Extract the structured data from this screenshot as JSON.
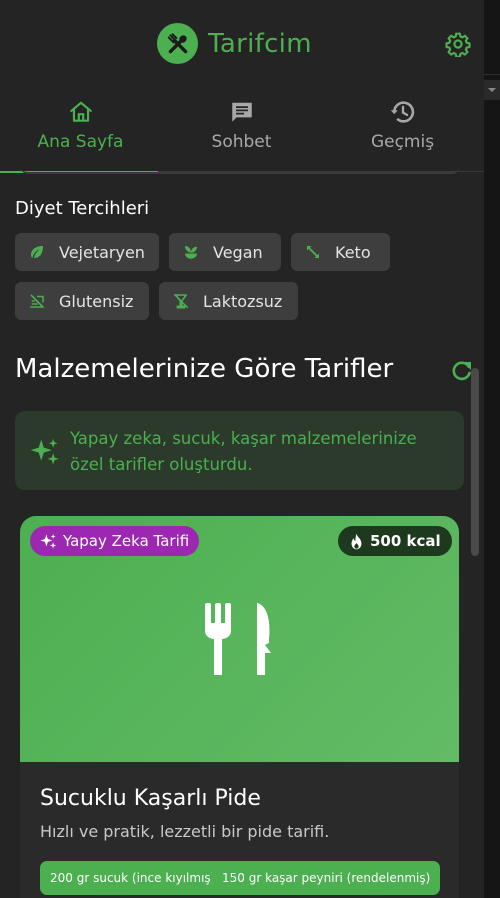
{
  "app": {
    "title": "Tarifcim",
    "brand_color": "#4caf50"
  },
  "tabs": [
    {
      "label": "Ana Sayfa",
      "icon": "home-icon",
      "active": true
    },
    {
      "label": "Sohbet",
      "icon": "chat-icon",
      "active": false
    },
    {
      "label": "Geçmiş",
      "icon": "history-icon",
      "active": false
    }
  ],
  "diet": {
    "title": "Diyet Tercihleri",
    "chips": [
      {
        "label": "Vejetaryen",
        "icon": "leaf-icon"
      },
      {
        "label": "Vegan",
        "icon": "sprout-icon"
      },
      {
        "label": "Keto",
        "icon": "arrows-icon"
      },
      {
        "label": "Glutensiz",
        "icon": "no-gluten-icon"
      },
      {
        "label": "Laktozsuz",
        "icon": "no-drink-icon"
      }
    ]
  },
  "recipes": {
    "heading": "Malzemelerinize Göre Tarifler",
    "ai_notice": "Yapay zeka, sucuk, kaşar malzemelerinize özel tarifler oluşturdu."
  },
  "card": {
    "badge_ai": "Yapay Zeka Tarifi",
    "badge_kcal": "500 kcal",
    "title": "Sucuklu Kaşarlı Pide",
    "description": "Hızlı ve pratik, lezzetli bir pide tarifi.",
    "ingredients": [
      "200 gr sucuk (ince kıyılmış)",
      "150 gr kaşar peyniri (rendelenmiş)"
    ],
    "hero_icon": "utensils-icon",
    "colors": {
      "ai_badge": "#9c27b0",
      "kcal_badge": "#1e3a1e"
    }
  }
}
